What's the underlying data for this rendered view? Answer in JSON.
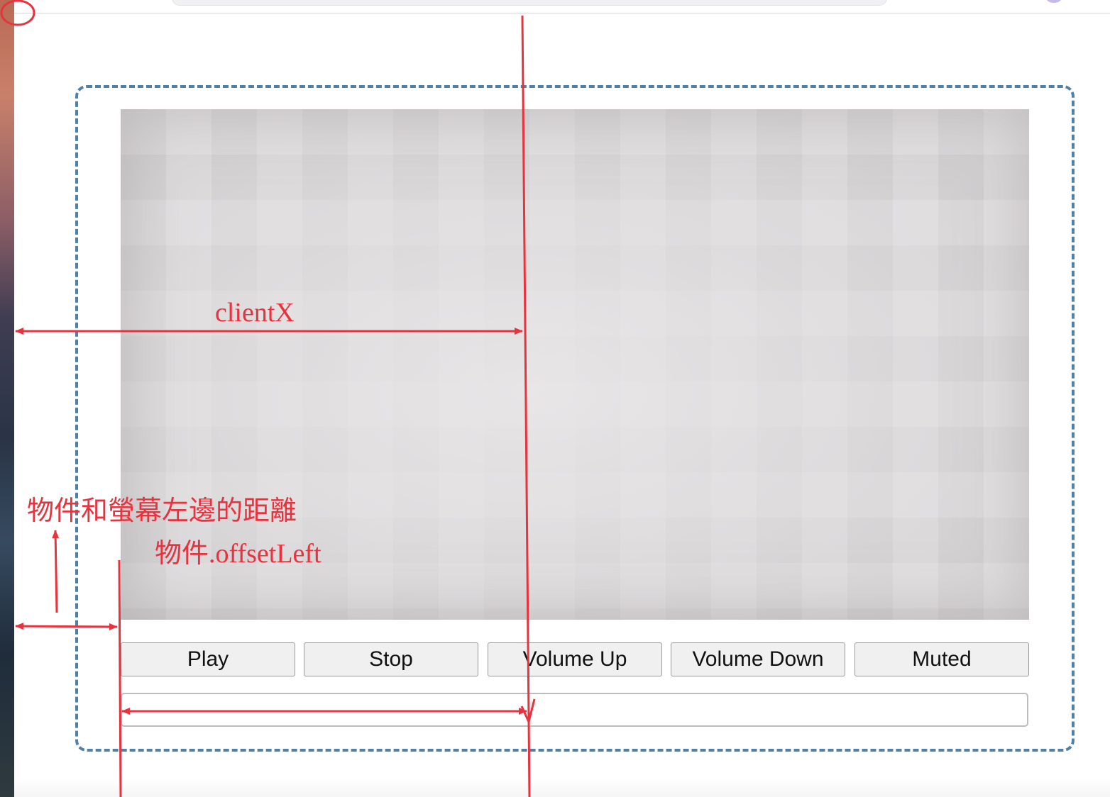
{
  "toolbar": {
    "buttons": [
      {
        "id": "play",
        "label": "Play"
      },
      {
        "id": "stop",
        "label": "Stop"
      },
      {
        "id": "volume-up",
        "label": "Volume Up"
      },
      {
        "id": "volume-down",
        "label": "Volume Down"
      },
      {
        "id": "muted",
        "label": "Muted"
      }
    ]
  },
  "annotations": {
    "clientx_label": "clientX",
    "distance_label": "物件和螢幕左邊的距離",
    "offsetleft_label": "物件.offsetLeft"
  },
  "colors": {
    "annotation": "#e8333f",
    "frame_border": "#4f81a8",
    "button_bg": "#f0f0f0"
  },
  "icons": [
    "cursor-origin-circle-icon"
  ]
}
